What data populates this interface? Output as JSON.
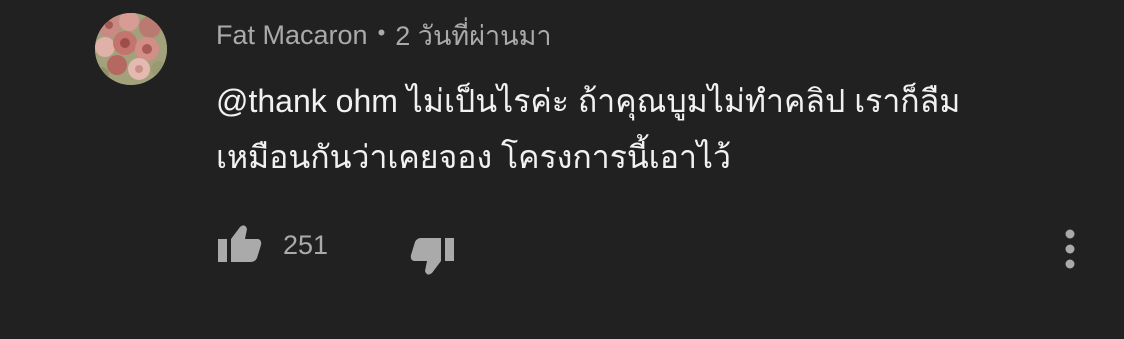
{
  "comment": {
    "author": "Fat Macaron",
    "separator": "•",
    "timestamp": "2 วันที่ผ่านมา",
    "text_lines": [
      "@thank ohm ไม่เป็นไรค่ะ ถ้าคุณบูมไม่ทำคลิป เราก็ลืม",
      "เหมือนกันว่าเคยจอง โครงการนี้เอาไว้"
    ],
    "like_count": "251"
  },
  "icons": {
    "like": "thumbs-up-icon",
    "dislike": "thumbs-down-icon",
    "more": "more-vertical-icon"
  },
  "colors": {
    "background": "#212121",
    "primary_text": "#f1f1f1",
    "secondary_text": "#aaaaaa",
    "icon": "#aaaaaa"
  }
}
